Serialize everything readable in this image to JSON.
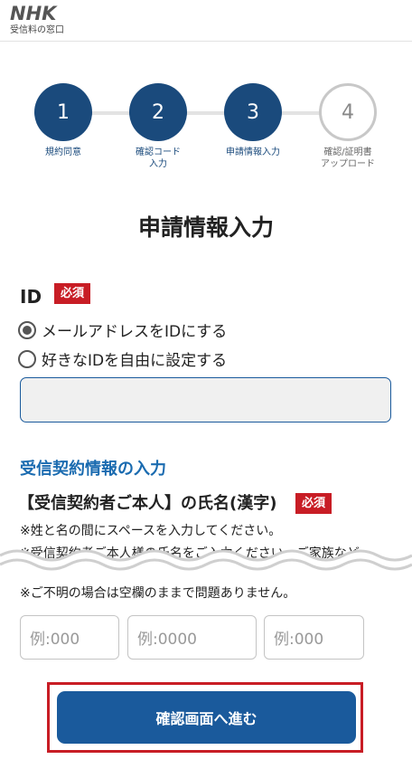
{
  "header": {
    "logo": "NHK",
    "subtitle": "受信料の窓口"
  },
  "steps": [
    {
      "number": "1",
      "label": "規約同意",
      "state": "done"
    },
    {
      "number": "2",
      "label": "確認コード\n入力",
      "state": "done"
    },
    {
      "number": "3",
      "label": "申請情報入力",
      "state": "current"
    },
    {
      "number": "4",
      "label": "確認/証明書\nアップロード",
      "state": "upcoming"
    }
  ],
  "page_title": "申請情報入力",
  "id_section": {
    "label": "ID",
    "required_badge": "必須",
    "options": [
      {
        "label": "メールアドレスをIDにする",
        "selected": true
      },
      {
        "label": "好きなIDを自由に設定する",
        "selected": false
      }
    ],
    "input_value": ""
  },
  "contract_section": {
    "title": "受信契約情報の入力",
    "name_label": "【受信契約者ご本人】の氏名(漢字)",
    "required_badge": "必須",
    "notes": [
      "※姓と名の間にスペースを入力してください。",
      "※受信契約者ご本人様の氏名をご入力ください。ご家族など",
      "※ご不明の場合は空欄のままで問題ありません。"
    ],
    "inputs": [
      {
        "placeholder": "例:000"
      },
      {
        "placeholder": "例:0000"
      },
      {
        "placeholder": "例:000"
      }
    ]
  },
  "submit": {
    "label": "確認画面へ進む"
  },
  "colors": {
    "primary": "#1a4a7c",
    "button": "#1a5a9c",
    "accent_red": "#c81d25",
    "section_blue": "#1a6bb0"
  }
}
